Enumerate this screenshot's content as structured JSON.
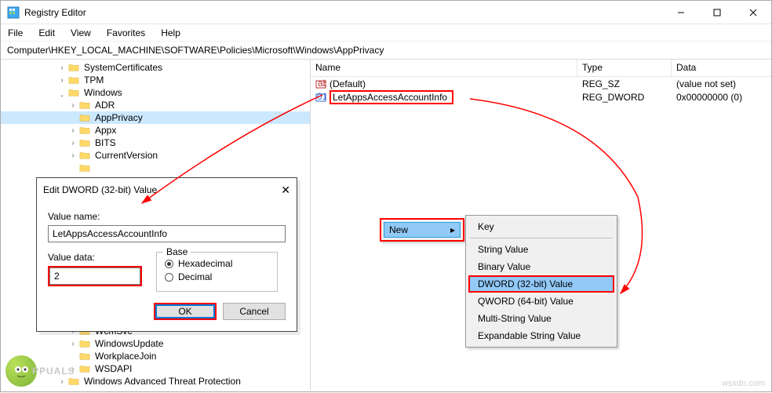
{
  "window": {
    "title": "Registry Editor"
  },
  "menu": {
    "file": "File",
    "edit": "Edit",
    "view": "View",
    "favorites": "Favorites",
    "help": "Help"
  },
  "address": "Computer\\HKEY_LOCAL_MACHINE\\SOFTWARE\\Policies\\Microsoft\\Windows\\AppPrivacy",
  "tree": [
    {
      "label": "SystemCertificates",
      "ind": 5,
      "exp": "r"
    },
    {
      "label": "TPM",
      "ind": 5,
      "exp": "r"
    },
    {
      "label": "Windows",
      "ind": 5,
      "exp": "d"
    },
    {
      "label": "ADR",
      "ind": 6,
      "exp": "r"
    },
    {
      "label": "AppPrivacy",
      "ind": 6,
      "sel": true
    },
    {
      "label": "Appx",
      "ind": 6,
      "exp": "r"
    },
    {
      "label": "BITS",
      "ind": 6,
      "exp": "r"
    },
    {
      "label": "CurrentVersion",
      "ind": 6,
      "exp": "r"
    },
    {
      "label": "",
      "ind": 6
    },
    {
      "label": "",
      "ind": 6
    },
    {
      "label": "",
      "ind": 6
    },
    {
      "label": "",
      "ind": 6
    },
    {
      "label": "",
      "ind": 6
    },
    {
      "label": "",
      "ind": 6
    },
    {
      "label": "",
      "ind": 6
    },
    {
      "label": "",
      "ind": 6
    },
    {
      "label": "",
      "ind": 6
    },
    {
      "label": "",
      "ind": 6
    },
    {
      "label": "",
      "ind": 6
    },
    {
      "label": "",
      "ind": 6
    },
    {
      "label": "",
      "ind": 6
    },
    {
      "label": "WcmSvc",
      "ind": 6,
      "exp": "r"
    },
    {
      "label": "WindowsUpdate",
      "ind": 6,
      "exp": "r"
    },
    {
      "label": "WorkplaceJoin",
      "ind": 6
    },
    {
      "label": "WSDAPI",
      "ind": 6,
      "exp": "r"
    },
    {
      "label": "Windows Advanced Threat Protection",
      "ind": 5,
      "exp": "r"
    }
  ],
  "cols": {
    "name": "Name",
    "type": "Type",
    "data": "Data"
  },
  "rows": [
    {
      "icon": "ab",
      "name": "(Default)",
      "type": "REG_SZ",
      "data": "(value not set)"
    },
    {
      "icon": "num",
      "name": "LetAppsAccessAccountInfo",
      "type": "REG_DWORD",
      "data": "0x00000000 (0)",
      "hl": true
    }
  ],
  "dialog": {
    "title": "Edit DWORD (32-bit) Value",
    "lbl_name": "Value name:",
    "name": "LetAppsAccessAccountInfo",
    "lbl_data": "Value data:",
    "value": "2",
    "base": "Base",
    "hex": "Hexadecimal",
    "dec": "Decimal",
    "ok": "OK",
    "cancel": "Cancel"
  },
  "ctx1": {
    "new": "New"
  },
  "ctx2": {
    "key": "Key",
    "string": "String Value",
    "binary": "Binary Value",
    "dword": "DWORD (32-bit) Value",
    "qword": "QWORD (64-bit) Value",
    "multi": "Multi-String Value",
    "expand": "Expandable String Value"
  },
  "wm": "PPUALS",
  "wm2": "wsxdn.com"
}
